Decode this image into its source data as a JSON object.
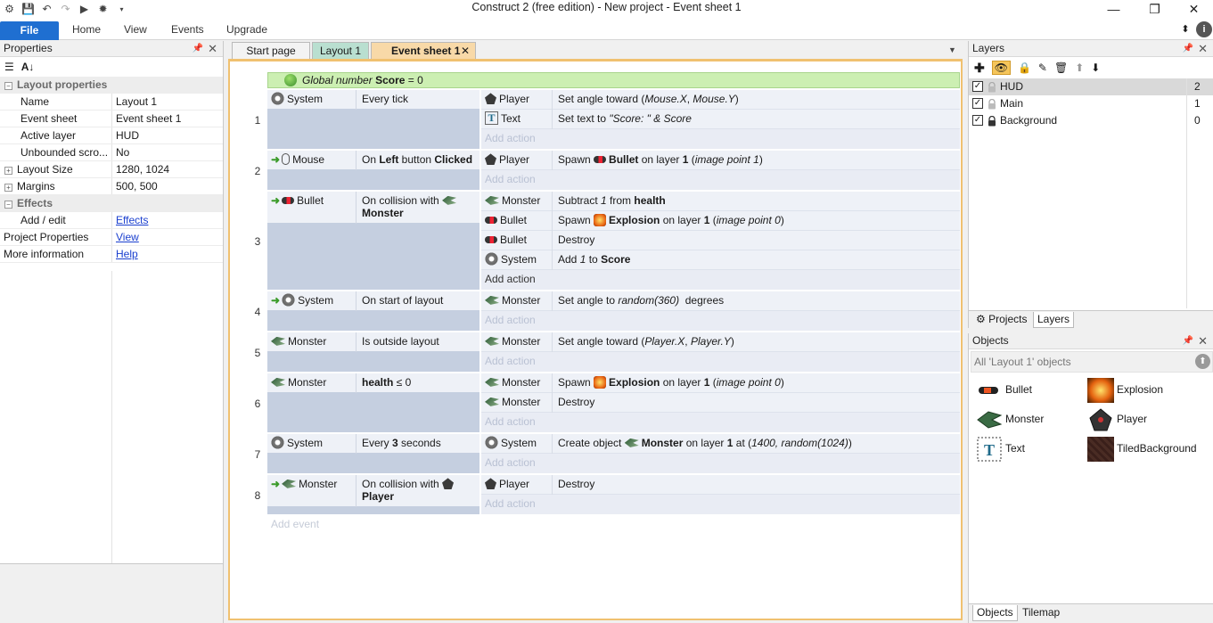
{
  "window": {
    "title": "Construct 2  (free edition) - New project - Event sheet 1",
    "minimize": "—",
    "restore": "❐",
    "close": "✕"
  },
  "ribbon": {
    "tabs": [
      "File",
      "Home",
      "View",
      "Events",
      "Upgrade"
    ],
    "collapse_icon": "⬍",
    "help_icon": "i"
  },
  "properties": {
    "title": "Properties",
    "rows": [
      {
        "key": "Layout properties",
        "value": "",
        "type": "category"
      },
      {
        "key": "Name",
        "value": "Layout 1"
      },
      {
        "key": "Event sheet",
        "value": "Event sheet 1"
      },
      {
        "key": "Active layer",
        "value": "HUD"
      },
      {
        "key": "Unbounded scro...",
        "value": "No"
      },
      {
        "key": "Layout Size",
        "value": "1280, 1024",
        "expand": true
      },
      {
        "key": "Margins",
        "value": "500, 500",
        "expand": true
      },
      {
        "key": "Effects",
        "value": "",
        "type": "category"
      },
      {
        "key": "Add / edit",
        "value": "Effects",
        "link": true
      },
      {
        "key": "Project Properties",
        "value": "View",
        "link": true,
        "toplevel": true
      },
      {
        "key": "More information",
        "value": "Help",
        "link": true,
        "toplevel": true
      }
    ]
  },
  "doc_tabs": [
    "Start page",
    "Layout 1",
    "Event sheet 1"
  ],
  "event_sheet": {
    "global": {
      "prefix": "Global number",
      "name": "Score",
      "suffix": "= 0"
    },
    "add_event": "Add event",
    "add_action": "Add action",
    "events": [
      {
        "n": "1",
        "conditions": [
          {
            "obj": "System",
            "text": "Every tick"
          }
        ],
        "actions": [
          {
            "obj": "Player",
            "text": "Set angle toward (Mouse.X, Mouse.Y)"
          },
          {
            "obj": "Text",
            "text": "Set text to \"Score: \" & Score"
          }
        ]
      },
      {
        "n": "2",
        "conditions": [
          {
            "obj": "Mouse",
            "text": "On Left button Clicked"
          }
        ],
        "actions": [
          {
            "obj": "Player",
            "text": "Spawn  Bullet on layer 1 (image point 1)"
          }
        ]
      },
      {
        "n": "3",
        "conditions": [
          {
            "obj": "Bullet",
            "text": "On collision with  Monster"
          }
        ],
        "actions": [
          {
            "obj": "Monster",
            "text": "Subtract 1 from health"
          },
          {
            "obj": "Bullet",
            "text": "Spawn  Explosion on layer 1 (image point 0)"
          },
          {
            "obj": "Bullet",
            "text": "Destroy"
          },
          {
            "obj": "System",
            "text": "Add 1 to Score"
          }
        ]
      },
      {
        "n": "4",
        "conditions": [
          {
            "obj": "System",
            "text": "On start of layout"
          }
        ],
        "actions": [
          {
            "obj": "Monster",
            "text": "Set angle to random(360)  degrees"
          }
        ]
      },
      {
        "n": "5",
        "conditions": [
          {
            "obj": "Monster",
            "text": "Is outside layout"
          }
        ],
        "actions": [
          {
            "obj": "Monster",
            "text": "Set angle toward (Player.X, Player.Y)"
          }
        ]
      },
      {
        "n": "6",
        "conditions": [
          {
            "obj": "Monster",
            "text": "health ≤ 0"
          }
        ],
        "actions": [
          {
            "obj": "Monster",
            "text": "Spawn  Explosion on layer 1 (image point 0)"
          },
          {
            "obj": "Monster",
            "text": "Destroy"
          }
        ]
      },
      {
        "n": "7",
        "conditions": [
          {
            "obj": "System",
            "text": "Every 3 seconds"
          }
        ],
        "actions": [
          {
            "obj": "System",
            "text": "Create object  Monster on layer 1 at (1400, random(1024))"
          }
        ]
      },
      {
        "n": "8",
        "conditions": [
          {
            "obj": "Monster",
            "text": "On collision with  Player"
          }
        ],
        "actions": [
          {
            "obj": "Player",
            "text": "Destroy"
          }
        ]
      }
    ]
  },
  "layers": {
    "title": "Layers",
    "items": [
      {
        "name": "HUD",
        "index": "2",
        "checked": true,
        "locked": false
      },
      {
        "name": "Main",
        "index": "1",
        "checked": true,
        "locked": false
      },
      {
        "name": "Background",
        "index": "0",
        "checked": true,
        "locked": true
      }
    ],
    "bottom_tabs": [
      "Projects",
      "Layers"
    ]
  },
  "objects": {
    "title": "Objects",
    "filter": "All 'Layout 1' objects",
    "items": [
      "Bullet",
      "Explosion",
      "Monster",
      "Player",
      "Text",
      "TiledBackground"
    ],
    "bottom_tabs": [
      "Objects",
      "Tilemap"
    ]
  },
  "colors": {
    "file_tab": "#1f6fd1",
    "global_var_bg": "#ccefb2",
    "event_tab": "#f8d9a8",
    "layout_tab": "#b9dfd0"
  }
}
